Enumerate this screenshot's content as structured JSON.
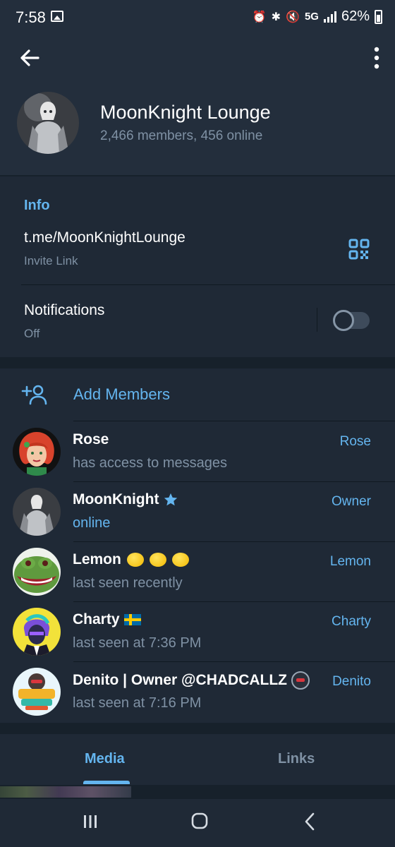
{
  "status_bar": {
    "time": "7:58",
    "network": "5G",
    "battery": "62%"
  },
  "header": {
    "title": "MoonKnight Lounge",
    "subtitle": "2,466 members, 456 online"
  },
  "info": {
    "section_title": "Info",
    "invite_link": "t.me/MoonKnightLounge",
    "invite_label": "Invite Link",
    "notifications_title": "Notifications",
    "notifications_status": "Off",
    "notifications_enabled": false
  },
  "add_members": {
    "label": "Add Members"
  },
  "members": [
    {
      "name": "Rose",
      "status": "has access to messages",
      "role": "Rose"
    },
    {
      "name": "MoonKnight",
      "status": "online",
      "role": "Owner"
    },
    {
      "name": "Lemon",
      "status": "last seen recently",
      "role": "Lemon"
    },
    {
      "name": "Charty",
      "status": "last seen at 7:36 PM",
      "role": "Charty"
    },
    {
      "name": "Denito | Owner @CHADCALLZ",
      "status": "last seen at 7:16 PM",
      "role": "Denito"
    }
  ],
  "tabs": {
    "media": "Media",
    "links": "Links"
  },
  "colors": {
    "accent": "#64b5ef",
    "background": "#17212b",
    "card": "#1f2936",
    "secondary_text": "#7f91a4"
  }
}
